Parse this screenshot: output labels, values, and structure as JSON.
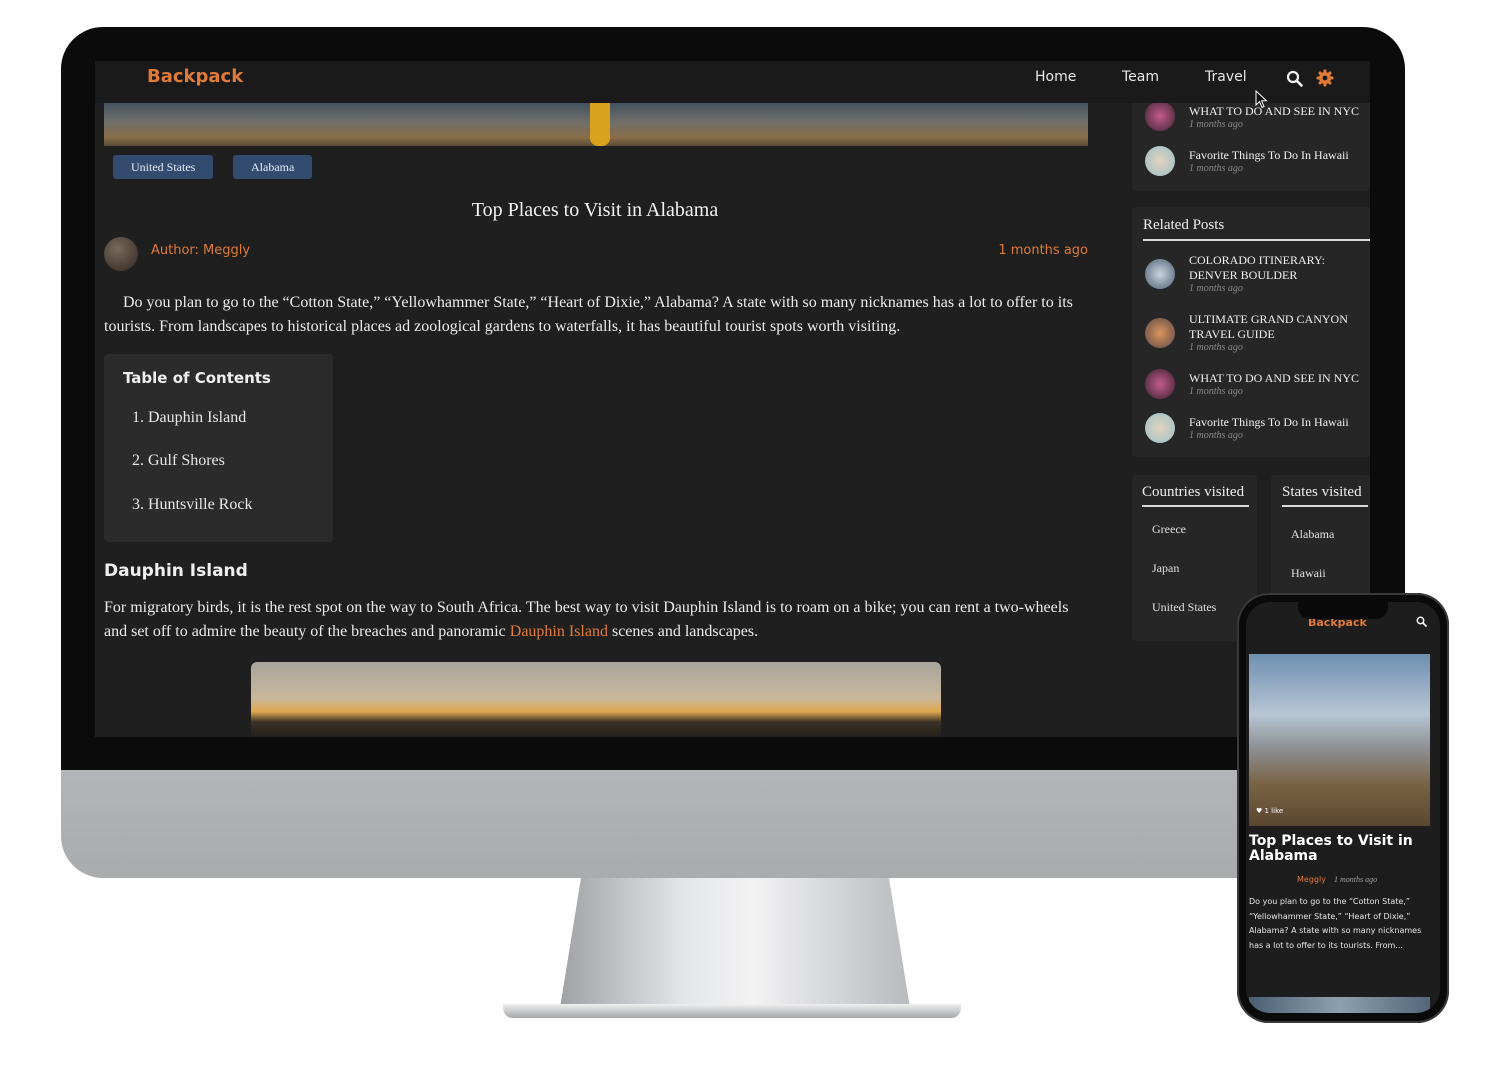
{
  "site": {
    "brand": "Backpack",
    "nav": [
      "Home",
      "Team",
      "Travel"
    ],
    "accent_color": "#e07a37",
    "tag_color": "#324b6e"
  },
  "article": {
    "tags": [
      "United States",
      "Alabama"
    ],
    "title": "Top Places to Visit in Alabama",
    "author": "Author: Meggly",
    "date": "1 months ago",
    "intro": "Do you plan to go to the “Cotton State,” “Yellowhammer State,” “Heart of Dixie,” Alabama? A state with so many nicknames has a lot to offer to its tourists. From landscapes to historical places ad zoological gardens to waterfalls, it has beautiful tourist spots worth visiting.",
    "toc": {
      "title": "Table of Contents",
      "items": [
        "1. Dauphin Island",
        "2. Gulf Shores",
        "3. Huntsville Rock"
      ]
    },
    "section": {
      "heading": "Dauphin Island",
      "text_before": "For migratory birds, it is the rest spot on the way to South Africa. The best way to visit Dauphin Island is to roam on a bike; you can rent a two-wheels and set off to admire the beauty of the breaches and panoramic ",
      "link": "Dauphin Island",
      "text_after": " scenes  and landscapes."
    }
  },
  "sidebar": {
    "recent_posts": [
      {
        "title": "WHAT TO DO AND SEE IN NYC",
        "meta": "1 months ago"
      },
      {
        "title": "Favorite Things To Do In Hawaii",
        "meta": "1 months ago"
      }
    ],
    "related": {
      "heading": "Related Posts",
      "posts": [
        {
          "title": "COLORADO ITINERARY: DENVER BOULDER",
          "meta": "1 months ago"
        },
        {
          "title": "ULTIMATE GRAND CANYON TRAVEL GUIDE",
          "meta": "1 months ago"
        },
        {
          "title": "WHAT TO DO AND SEE IN NYC",
          "meta": "1 months ago"
        },
        {
          "title": "Favorite Things To Do In Hawaii",
          "meta": "1 months ago"
        }
      ]
    },
    "countries": {
      "heading": "Countries visited",
      "items": [
        "Greece",
        "Japan",
        "United States"
      ]
    },
    "states": {
      "heading": "States visited",
      "items": [
        "Alabama",
        "Hawaii"
      ]
    }
  },
  "phone": {
    "brand": "Backpack",
    "likes": "♥ 1 like",
    "title": "Top Places to Visit in Alabama",
    "author": "Meggly",
    "date": "1 months ago",
    "excerpt": "Do you plan to go to the “Cotton State,” “Yellowhammer State,” “Heart of Dixie,” Alabama? A state with so many nicknames has a lot to offer to its tourists. From..."
  }
}
